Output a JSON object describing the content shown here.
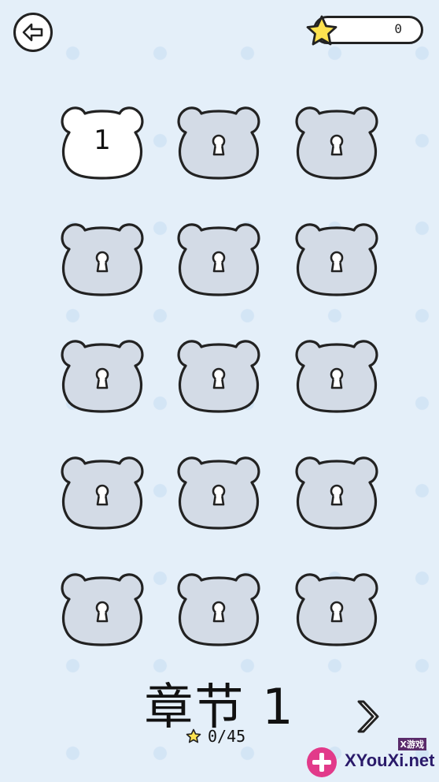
{
  "header": {
    "back_icon": "back-arrow-icon",
    "star_icon": "star-icon",
    "star_count": "0"
  },
  "levels": [
    {
      "label": "1",
      "locked": false
    },
    {
      "label": "",
      "locked": true
    },
    {
      "label": "",
      "locked": true
    },
    {
      "label": "",
      "locked": true
    },
    {
      "label": "",
      "locked": true
    },
    {
      "label": "",
      "locked": true
    },
    {
      "label": "",
      "locked": true
    },
    {
      "label": "",
      "locked": true
    },
    {
      "label": "",
      "locked": true
    },
    {
      "label": "",
      "locked": true
    },
    {
      "label": "",
      "locked": true
    },
    {
      "label": "",
      "locked": true
    },
    {
      "label": "",
      "locked": true
    },
    {
      "label": "",
      "locked": true
    },
    {
      "label": "",
      "locked": true
    }
  ],
  "chapter": {
    "title": "章节 1",
    "progress": "0/45",
    "next_icon": "chevron-right-icon"
  },
  "watermark": {
    "top": "X游戏",
    "main": "XYouXi.net"
  },
  "colors": {
    "background": "#e4eff9",
    "locked_face": "#d3dbe6",
    "unlocked_face": "#ffffff",
    "outline": "#222222",
    "star": "#fde24f"
  }
}
